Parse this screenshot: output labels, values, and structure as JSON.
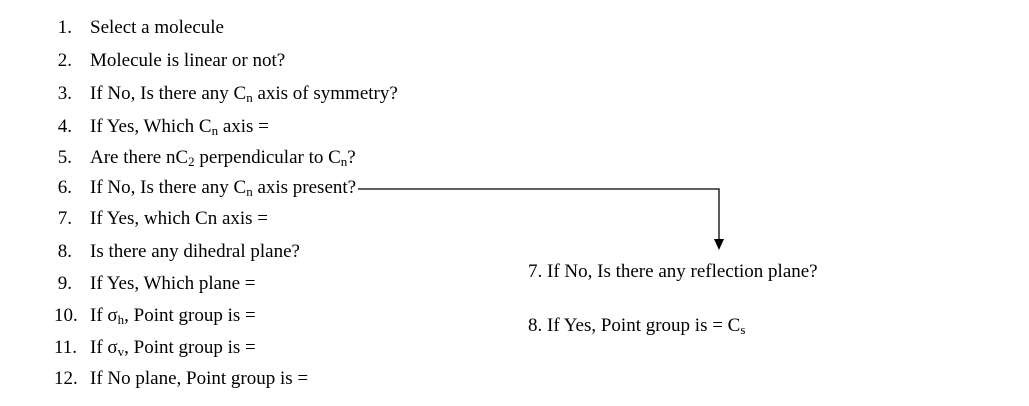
{
  "main_steps": [
    {
      "num": "1.",
      "pre": "Select a molecule"
    },
    {
      "num": "2.",
      "pre": "Molecule is linear or not?"
    },
    {
      "num": "3.",
      "pre": "If No, Is there any C",
      "sub": "n",
      "post": " axis of symmetry?"
    },
    {
      "num": "4.",
      "pre": "If Yes, Which C",
      "sub": "n",
      "post": " axis ="
    },
    {
      "num": "5.",
      "pre": "Are there nC",
      "sub": "2",
      "post": " perpendicular to C",
      "sub2": "n",
      "post2": "?"
    },
    {
      "num": "6.",
      "pre": "If No, Is there any C",
      "sub": "n",
      "post": " axis present?"
    },
    {
      "num": "7.",
      "pre": "If Yes, which Cn axis ="
    },
    {
      "num": "8.",
      "pre": "Is there any dihedral plane?"
    },
    {
      "num": "9.",
      "pre": "If Yes, Which plane ="
    },
    {
      "num": "10.",
      "pre": "If σ",
      "sub": "h",
      "post": ", Point group is ="
    },
    {
      "num": "11.",
      "pre": "If σ",
      "sub": "v",
      "post": ", Point group is ="
    },
    {
      "num": "12.",
      "pre": "If No plane, Point group is ="
    }
  ],
  "branch_steps": [
    {
      "pre": "7. If No, Is there any reflection plane?"
    },
    {
      "pre": "8. If Yes, Point group is = C",
      "sub": "s"
    }
  ],
  "connector": {
    "from": "main_steps.5",
    "to": "branch_steps.0",
    "color": "#000000"
  }
}
